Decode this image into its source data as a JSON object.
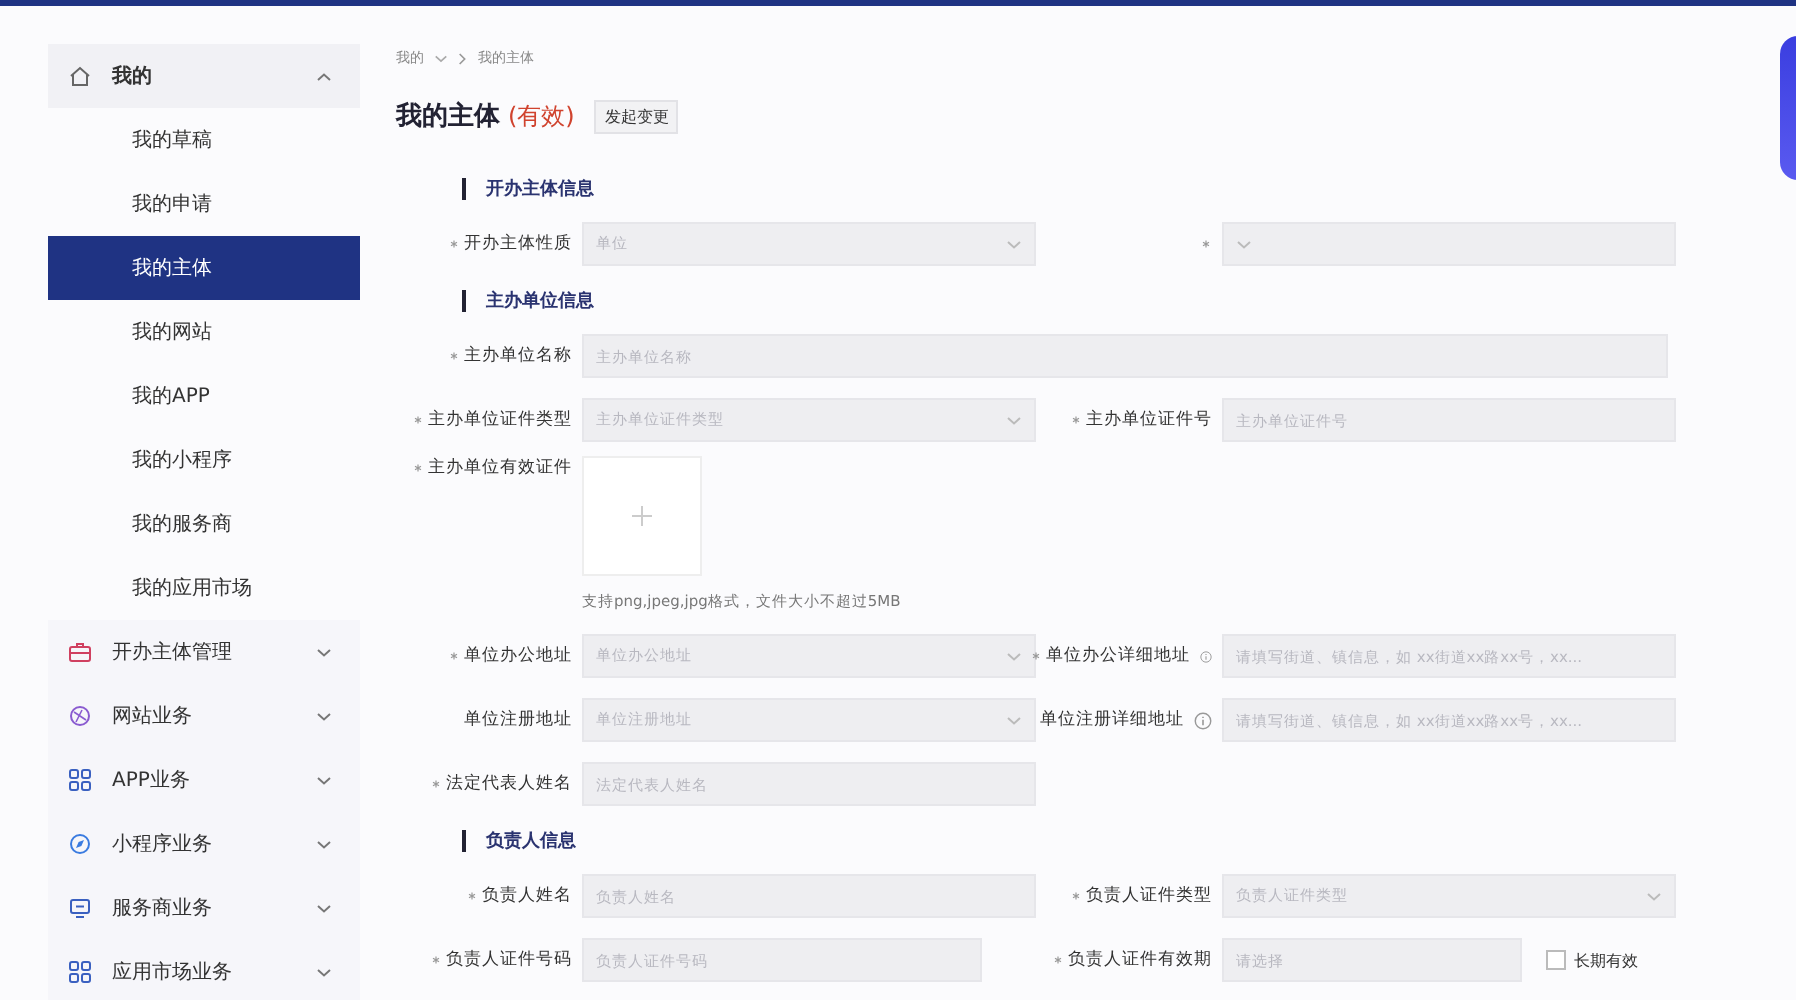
{
  "sidebar": {
    "items": [
      {
        "label": "我的",
        "expanded": true,
        "children": [
          {
            "label": "我的草稿",
            "selected": false
          },
          {
            "label": "我的申请",
            "selected": false
          },
          {
            "label": "我的主体",
            "selected": true
          },
          {
            "label": "我的网站",
            "selected": false
          },
          {
            "label": "我的APP",
            "selected": false
          },
          {
            "label": "我的小程序",
            "selected": false
          },
          {
            "label": "我的服务商",
            "selected": false
          },
          {
            "label": "我的应用市场",
            "selected": false
          }
        ]
      },
      {
        "label": "开办主体管理",
        "expanded": false
      },
      {
        "label": "网站业务",
        "expanded": false
      },
      {
        "label": "APP业务",
        "expanded": false
      },
      {
        "label": "小程序业务",
        "expanded": false
      },
      {
        "label": "服务商业务",
        "expanded": false
      },
      {
        "label": "应用市场业务",
        "expanded": false
      }
    ]
  },
  "breadcrumb": [
    "我的",
    "我的主体"
  ],
  "page": {
    "title": "我的主体",
    "status": "(有效)",
    "action": "发起变更"
  },
  "form": [
    {
      "kind": "section",
      "title": "开办主体信息"
    },
    {
      "kind": "row",
      "fields": [
        {
          "label": "开办主体性质",
          "required": true,
          "kind": "select",
          "placeholder": "单位"
        },
        {
          "required": true,
          "kind": "select"
        }
      ]
    },
    {
      "kind": "section",
      "title": "主办单位信息"
    },
    {
      "kind": "row",
      "fields": [
        {
          "label": "主办单位名称",
          "required": true,
          "kind": "input",
          "wide": true,
          "placeholder": "主办单位名称"
        }
      ]
    },
    {
      "kind": "row",
      "fields": [
        {
          "label": "主办单位证件类型",
          "required": true,
          "kind": "select",
          "placeholder": "主办单位证件类型"
        },
        {
          "label": "主办单位证件号",
          "required": true,
          "kind": "input",
          "placeholder": "主办单位证件号"
        }
      ]
    },
    {
      "kind": "upload",
      "label": "主办单位有效证件",
      "required": true,
      "hint": "支持png,jpeg,jpg格式，文件大小不超过5MB"
    },
    {
      "kind": "row",
      "fields": [
        {
          "label": "单位办公地址",
          "required": true,
          "kind": "select",
          "placeholder": "单位办公地址"
        },
        {
          "label": "单位办公详细地址",
          "required": true,
          "kind": "input",
          "info": true,
          "placeholder": "请填写街道、镇信息，如 xx街道xx路xx号，xx..."
        }
      ]
    },
    {
      "kind": "row",
      "fields": [
        {
          "label": "单位注册地址",
          "required": false,
          "kind": "select",
          "placeholder": "单位注册地址"
        },
        {
          "label": "单位注册详细地址",
          "required": false,
          "kind": "input",
          "info": true,
          "placeholder": "请填写街道、镇信息，如 xx街道xx路xx号，xx..."
        }
      ]
    },
    {
      "kind": "row",
      "fields": [
        {
          "label": "法定代表人姓名",
          "required": true,
          "kind": "input",
          "placeholder": "法定代表人姓名"
        }
      ]
    },
    {
      "kind": "section",
      "title": "负责人信息"
    },
    {
      "kind": "row",
      "fields": [
        {
          "label": "负责人姓名",
          "required": true,
          "kind": "input",
          "placeholder": "负责人姓名"
        },
        {
          "label": "负责人证件类型",
          "required": true,
          "kind": "select",
          "placeholder": "负责人证件类型"
        }
      ]
    },
    {
      "kind": "row",
      "fields": [
        {
          "label": "负责人证件号码",
          "required": true,
          "kind": "input",
          "short": true,
          "placeholder": "负责人证件号码"
        },
        {
          "label": "负责人证件有效期",
          "required": true,
          "kind": "date",
          "placeholder": "请选择",
          "checkbox": {
            "label": "长期有效",
            "checked": false
          }
        }
      ]
    }
  ]
}
